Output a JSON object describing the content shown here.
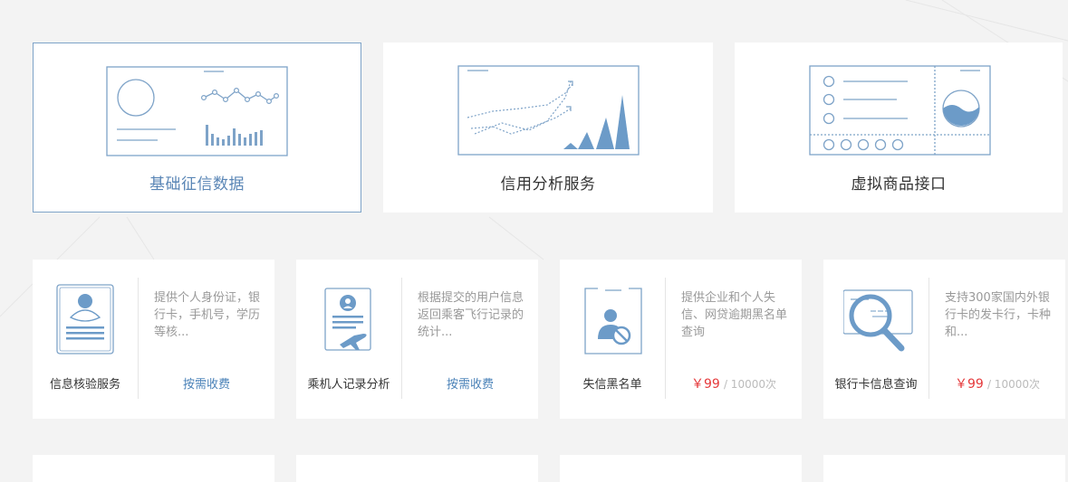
{
  "categories": [
    {
      "label": "基础征信数据",
      "active": true
    },
    {
      "label": "信用分析服务",
      "active": false
    },
    {
      "label": "虚拟商品接口",
      "active": false
    }
  ],
  "services": [
    {
      "name": "信息核验服务",
      "description": "提供个人身份证，银行卡，手机号，学历等核...",
      "price_text": "按需收费",
      "icon": "id-card-icon"
    },
    {
      "name": "乘机人记录分析",
      "description": "根据提交的用户信息返回乘客飞行记录的统计...",
      "price_text": "按需收费",
      "icon": "flight-record-icon"
    },
    {
      "name": "失信黑名单",
      "description": "提供企业和个人失信、网贷逾期黑名单查询",
      "price": "￥99",
      "unit": "/ 10000次",
      "icon": "blacklist-icon"
    },
    {
      "name": "银行卡信息查询",
      "description": "支持300家国内外银行卡的发卡行，卡种和...",
      "price": "￥99",
      "unit": "/ 10000次",
      "icon": "bank-card-search-icon"
    }
  ],
  "colors": {
    "accent": "#5a86b6",
    "icon_stroke": "#7ea3c8",
    "price_red": "#e5393b",
    "link_blue": "#4a82b8"
  }
}
